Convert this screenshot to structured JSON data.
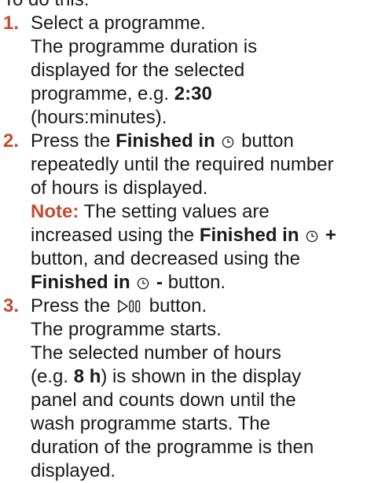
{
  "intro": "To do this:",
  "steps": [
    {
      "number": "1.",
      "lines": [
        "Select a programme.",
        "The programme duration is",
        "displayed for the selected",
        "programme, e.g.",
        "2:30",
        "(hours:minutes)."
      ]
    },
    {
      "number": "2.",
      "lines": [
        "Press the",
        "Finished in",
        "button",
        "repeatedly until the required number",
        "of hours is displayed."
      ],
      "note": {
        "label": "Note:",
        "lines": [
          "The setting values are",
          "increased using the",
          "Finished in",
          "+",
          "button, and decreased using the",
          "Finished in",
          "-",
          "button."
        ]
      }
    },
    {
      "number": "3.",
      "lines": [
        "Press the",
        "button.",
        "The programme starts.",
        "The selected number of hours",
        "(e.g.",
        "8 h",
        ") is shown in the display",
        "panel and counts down until the",
        "wash programme starts. The",
        "duration of the programme is then",
        "displayed."
      ]
    }
  ],
  "icons": {
    "clock": "clock-icon",
    "start_pause": "start-pause-icon"
  }
}
